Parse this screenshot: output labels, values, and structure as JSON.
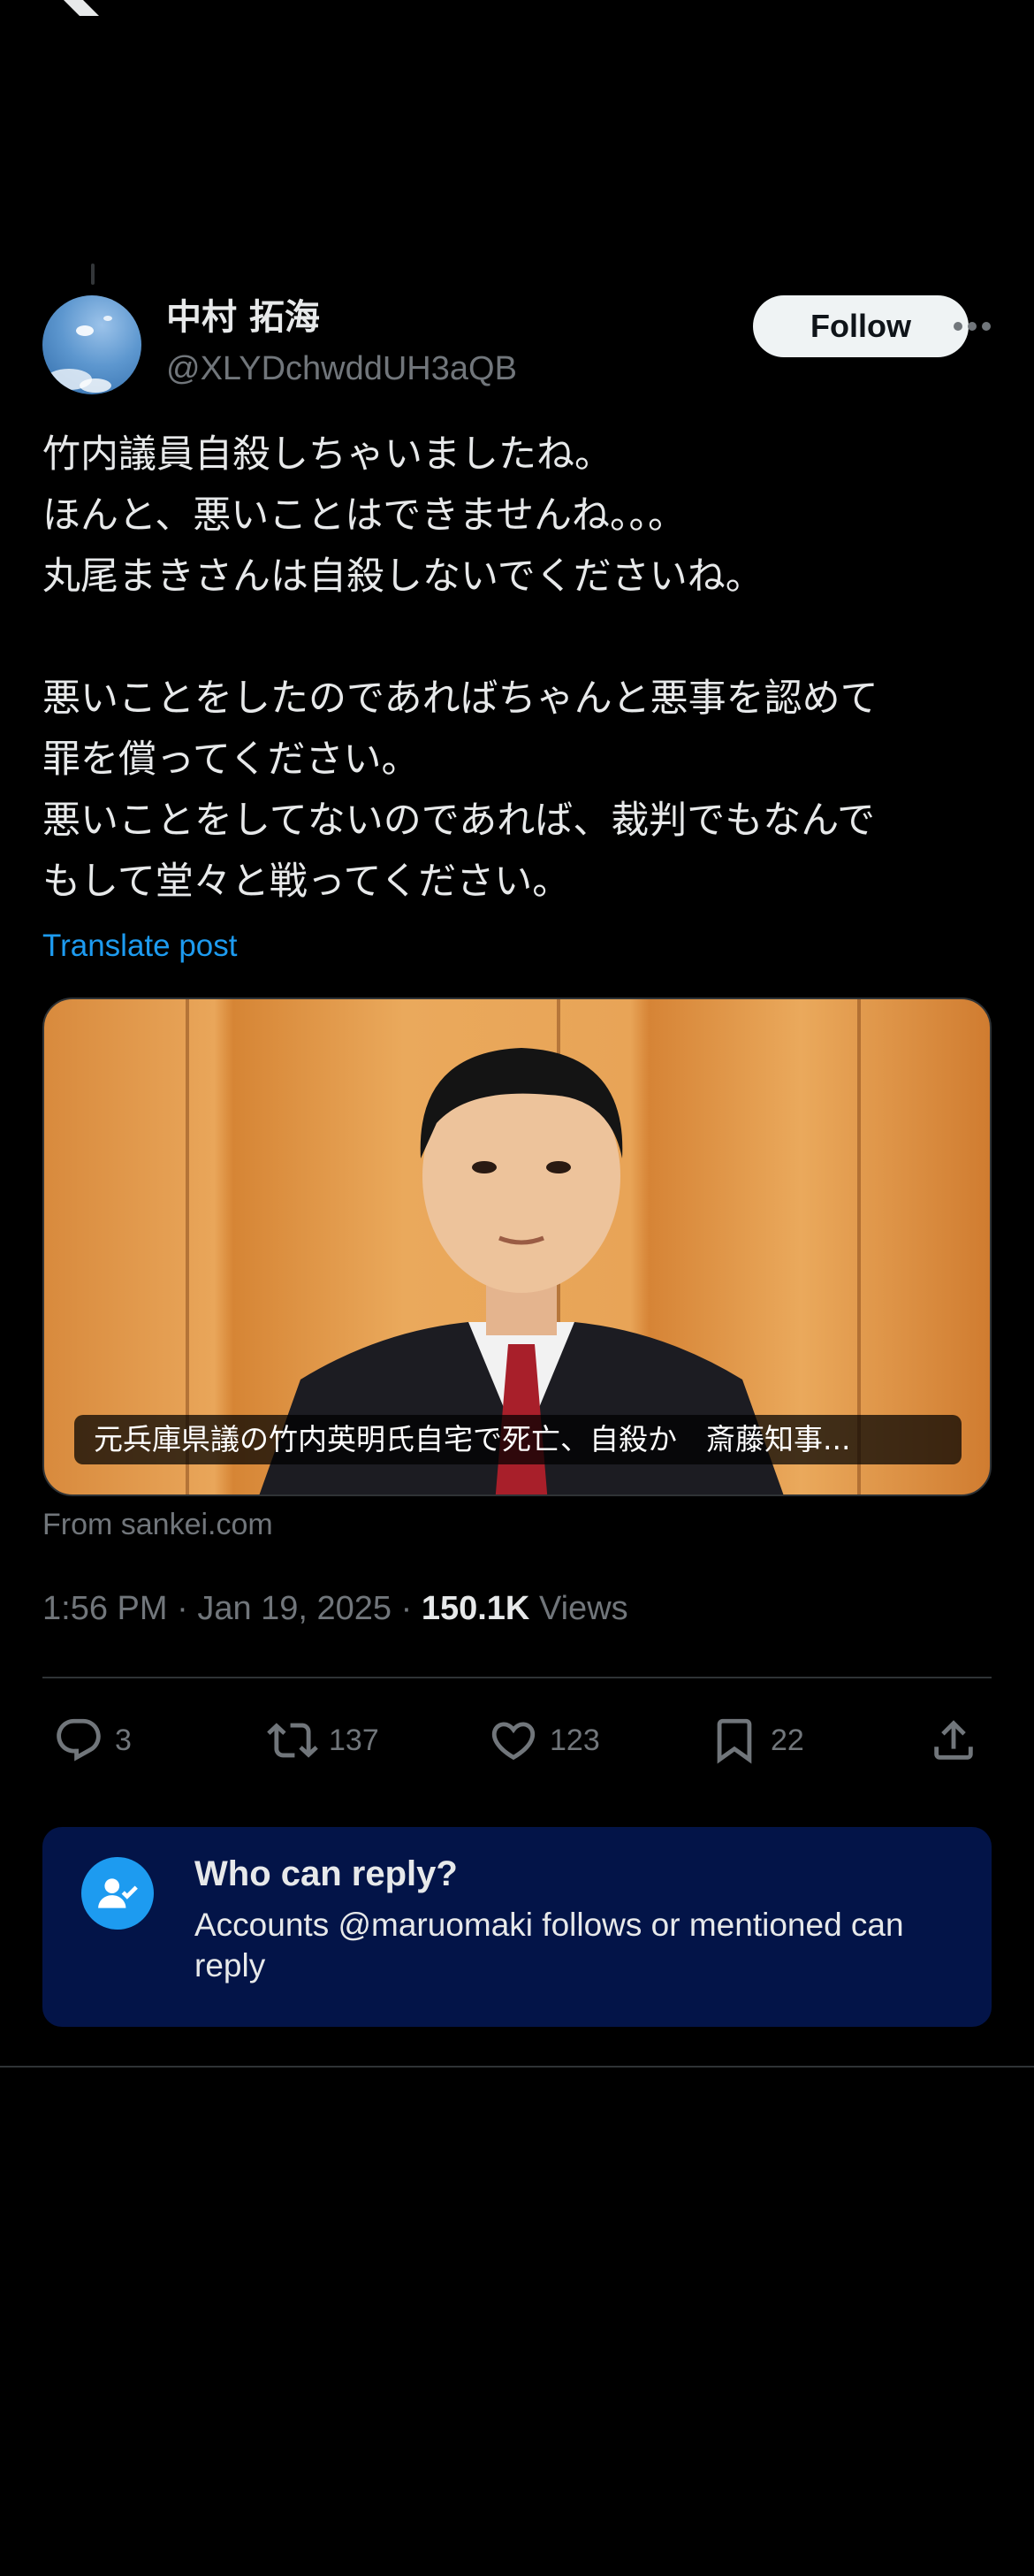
{
  "app": {
    "logo_icon": "x-logo-icon"
  },
  "author": {
    "display_name": "中村 拓海",
    "handle": "@XLYDchwddUH3aQB",
    "follow_label": "Follow"
  },
  "tweet": {
    "text": "竹内議員自殺しちゃいましたね。\nほんと、悪いことはできませんね。。。\n丸尾まきさんは自殺しないでくださいね。\n\n悪いことをしたのであればちゃんと悪事を認めて\n罪を償ってください。\n悪いことをしてないのであれば、裁判でもなんで\nもして堂々と戦ってください。",
    "translate_label": "Translate post"
  },
  "card": {
    "caption": "元兵庫県議の竹内英明氏自宅で死亡、自殺か　斎藤知事...",
    "source": "From sankei.com"
  },
  "meta": {
    "time": "1:56 PM",
    "date": "Jan 19, 2025",
    "views_count": "150.1K",
    "views_label": "Views"
  },
  "actions": {
    "replies": "3",
    "reposts": "137",
    "likes": "123",
    "bookmarks": "22"
  },
  "reply_settings": {
    "title": "Who can reply?",
    "description": "Accounts @maruomaki follows or mentioned can reply"
  },
  "colors": {
    "accent": "#1d9bf0",
    "background": "#000000",
    "reply_box": "#031448"
  }
}
